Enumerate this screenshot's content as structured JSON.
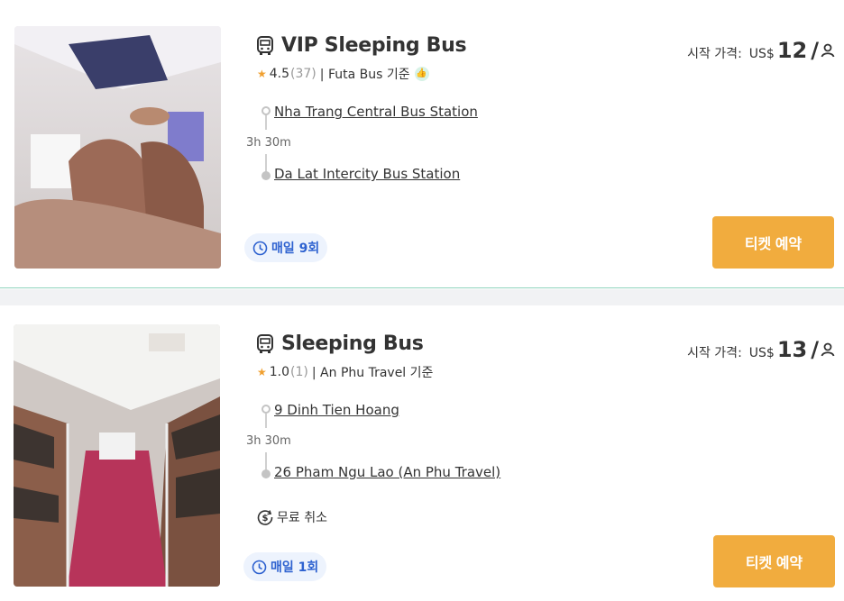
{
  "listings": [
    {
      "title": "VIP Sleeping Bus",
      "rating": "4.5",
      "review_count": "(37)",
      "operator_text": "| Futa Bus 기준",
      "verified": true,
      "from_station": "Nha Trang Central Bus Station",
      "duration": "3h 30m",
      "to_station": "Da Lat Intercity Bus Station",
      "price_label": "시작 가격:",
      "currency": "US$",
      "price": "12",
      "slash": "/",
      "frequency": "매일 9회",
      "book_label": "티켓 예약"
    },
    {
      "title": "Sleeping Bus",
      "rating": "1.0",
      "review_count": "(1)",
      "operator_text": "| An Phu Travel 기준",
      "verified": false,
      "from_station": "9 Dinh Tien Hoang",
      "duration": "3h 30m",
      "to_station": "26 Pham Ngu Lao (An Phu Travel)",
      "price_label": "시작 가격:",
      "currency": "US$",
      "price": "13",
      "slash": "/",
      "cancellation": "무료 취소",
      "frequency": "매일 1회",
      "book_label": "티켓 예약"
    }
  ],
  "icons": {
    "bus": "bus-icon",
    "star": "★",
    "thumb": "👍",
    "person": "person-icon",
    "clock": "clock-icon",
    "cancel": "dollar-cancel-icon"
  },
  "colors": {
    "book_button": "#f1ac3e",
    "frequency_bg": "#edf3fd",
    "frequency_text": "#2e62d0",
    "star": "#f0a030",
    "verified_badge": "#2fb07f",
    "divider": "#8fd3bd"
  }
}
